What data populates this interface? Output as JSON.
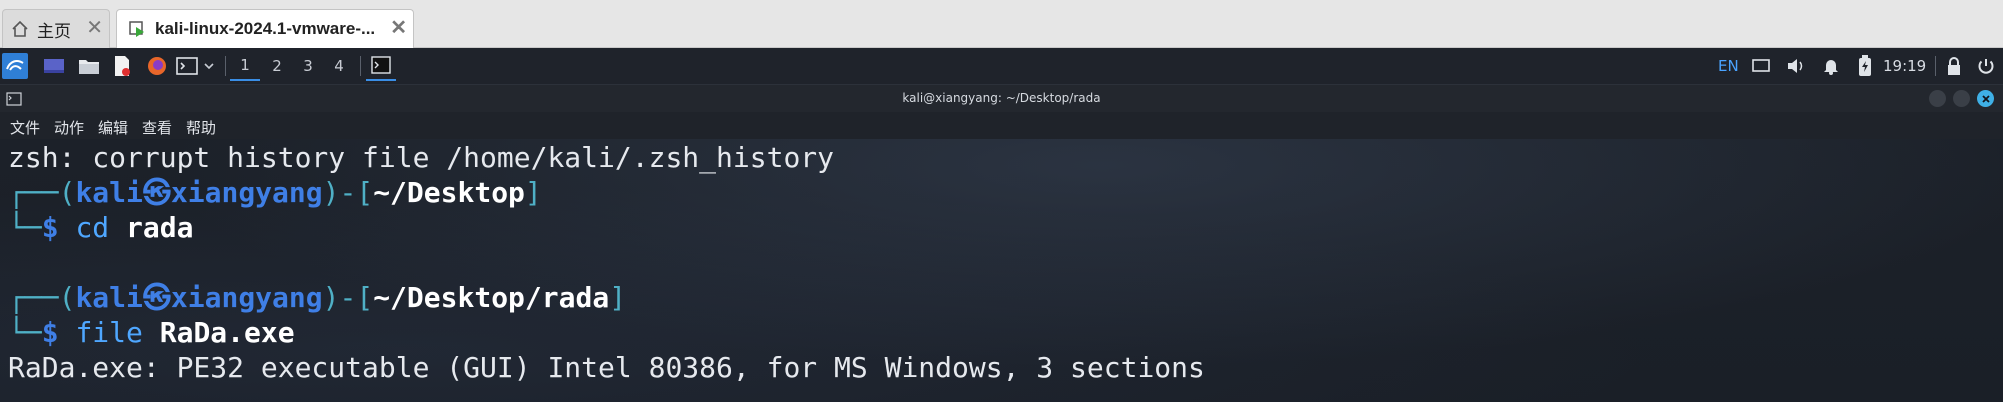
{
  "browser_tabs": {
    "home": {
      "label": "主页",
      "icon": "home-icon"
    },
    "vm": {
      "label": "kali-linux-2024.1-vmware-...",
      "icon": "vm-icon"
    }
  },
  "panel": {
    "workspaces": [
      "1",
      "2",
      "3",
      "4"
    ],
    "active_workspace": "1",
    "language": "EN",
    "clock": "19:19"
  },
  "window": {
    "title": "kali@xiangyang: ~/Desktop/rada"
  },
  "menu": [
    "文件",
    "动作",
    "编辑",
    "查看",
    "帮助"
  ],
  "terminal": {
    "line1": "zsh: corrupt history file /home/kali/.zsh_history",
    "prompt1": {
      "frame_top": "┌──(",
      "user": "kali",
      "host": "xiangyang",
      "frame_mid": ")-[",
      "path": "~/Desktop",
      "frame_end": "]",
      "frame_bottom": "└─",
      "symbol": "$",
      "command": "cd",
      "argument": "rada"
    },
    "prompt2": {
      "frame_top": "┌──(",
      "user": "kali",
      "host": "xiangyang",
      "frame_mid": ")-[",
      "path": "~/Desktop/rada",
      "frame_end": "]",
      "frame_bottom": "└─",
      "symbol": "$",
      "command": "file",
      "argument": "RaDa.exe"
    },
    "output": "RaDa.exe: PE32 executable (GUI) Intel 80386, for MS Windows, 3 sections"
  },
  "colors": {
    "prompt_blue": "#3f7fe6",
    "frame_cyan": "#4fb0c6",
    "terminal_bg": "#1c2129",
    "close_red": "#3fb0e6"
  }
}
